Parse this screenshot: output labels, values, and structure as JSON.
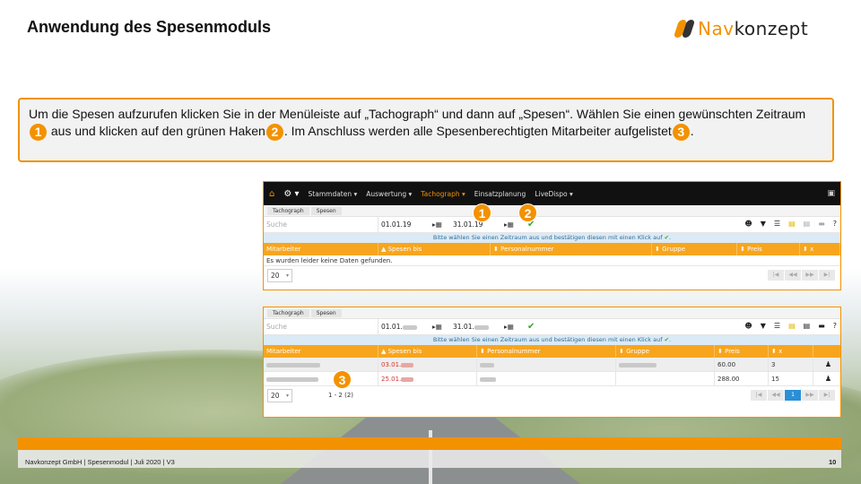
{
  "slide": {
    "title": "Anwendung des Spesenmoduls",
    "logo": {
      "part1": "Nav",
      "part2": "konzept"
    },
    "instructions": {
      "text1": "Um die Spesen aufzurufen klicken Sie in der Menüleiste auf „Tachograph“ und dann auf „Spesen“. Wählen Sie einen gewünschten Zeitraum",
      "badge1": "1",
      "text2": " aus und klicken auf den grünen Haken",
      "badge2": "2",
      "text3": ". Im Anschluss werden alle Spesenberechtigten Mitarbeiter aufgelistet",
      "badge3": "3",
      "text4": "."
    },
    "footer": {
      "text": "Navkonzept GmbH | Spesenmodul | Juli 2020 | V3",
      "page": "10"
    },
    "accent_color": "#f39200"
  },
  "app": {
    "menu": [
      "Stammdaten",
      "Auswertung",
      "Tachograph",
      "Einsatzplanung",
      "LiveDispo"
    ],
    "breadcrumb": [
      "Tachograph",
      "Spesen"
    ],
    "search_placeholder": "Suche",
    "hint_text": "Bitte wählen Sie einen Zeitraum aus und bestätigen diesen mit einen Klick auf",
    "columns": [
      "Mitarbeiter",
      "Spesen bis",
      "Personalnummer",
      "Gruppe",
      "Preis",
      "x"
    ],
    "panel1": {
      "date_from": "01.01.19",
      "date_to": "31.01.19",
      "empty_message": "Es wurden leider keine Daten gefunden.",
      "page_size": "20"
    },
    "panel2": {
      "date_from": "01.01.",
      "date_to": "31.01.",
      "rows": [
        {
          "spesen_bis": "03.01.",
          "preis": "60.00",
          "x": "3"
        },
        {
          "spesen_bis": "25.01.",
          "preis": "288.00",
          "x": "15"
        }
      ],
      "page_size": "20",
      "page_info": "1 - 2 (2)",
      "current_page": "1"
    },
    "callouts": [
      "1",
      "2",
      "3"
    ]
  }
}
